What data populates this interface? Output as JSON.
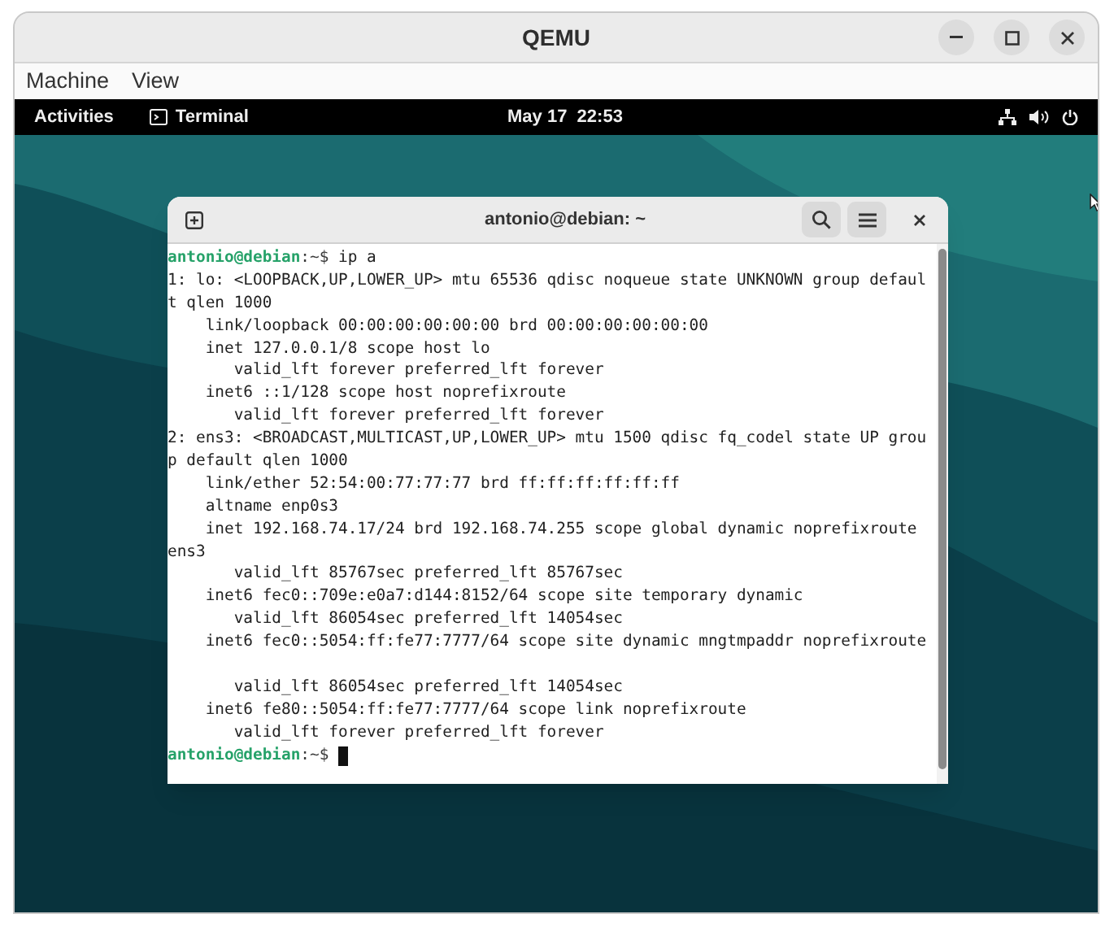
{
  "window": {
    "title": "QEMU"
  },
  "menu": [
    "Machine",
    "View"
  ],
  "top_bar": {
    "activities": "Activities",
    "app": "Terminal",
    "clock": "May 17  22:53"
  },
  "terminal": {
    "title": "antonio@debian: ~",
    "lines": [
      {
        "kind": "prompt",
        "user": "antonio@debian",
        "path": ":~$",
        "command": " ip a"
      },
      {
        "kind": "output",
        "text": "1: lo: <LOOPBACK,UP,LOWER_UP> mtu 65536 qdisc noqueue state UNKNOWN group defaul"
      },
      {
        "kind": "output",
        "text": "t qlen 1000"
      },
      {
        "kind": "output",
        "text": "    link/loopback 00:00:00:00:00:00 brd 00:00:00:00:00:00"
      },
      {
        "kind": "output",
        "text": "    inet 127.0.0.1/8 scope host lo"
      },
      {
        "kind": "output",
        "text": "       valid_lft forever preferred_lft forever"
      },
      {
        "kind": "output",
        "text": "    inet6 ::1/128 scope host noprefixroute"
      },
      {
        "kind": "output",
        "text": "       valid_lft forever preferred_lft forever"
      },
      {
        "kind": "output",
        "text": "2: ens3: <BROADCAST,MULTICAST,UP,LOWER_UP> mtu 1500 qdisc fq_codel state UP grou"
      },
      {
        "kind": "output",
        "text": "p default qlen 1000"
      },
      {
        "kind": "output",
        "text": "    link/ether 52:54:00:77:77:77 brd ff:ff:ff:ff:ff:ff"
      },
      {
        "kind": "output",
        "text": "    altname enp0s3"
      },
      {
        "kind": "output",
        "text": "    inet 192.168.74.17/24 brd 192.168.74.255 scope global dynamic noprefixroute"
      },
      {
        "kind": "output",
        "text": "ens3"
      },
      {
        "kind": "output",
        "text": "       valid_lft 85767sec preferred_lft 85767sec"
      },
      {
        "kind": "output",
        "text": "    inet6 fec0::709e:e0a7:d144:8152/64 scope site temporary dynamic"
      },
      {
        "kind": "output",
        "text": "       valid_lft 86054sec preferred_lft 14054sec"
      },
      {
        "kind": "output",
        "text": "    inet6 fec0::5054:ff:fe77:7777/64 scope site dynamic mngtmpaddr noprefixroute"
      },
      {
        "kind": "blank"
      },
      {
        "kind": "output",
        "text": "       valid_lft 86054sec preferred_lft 14054sec"
      },
      {
        "kind": "output",
        "text": "    inet6 fe80::5054:ff:fe77:7777/64 scope link noprefixroute"
      },
      {
        "kind": "output",
        "text": "       valid_lft forever preferred_lft forever"
      },
      {
        "kind": "prompt",
        "user": "antonio@debian",
        "path": ":~$",
        "cursor": true
      }
    ]
  }
}
